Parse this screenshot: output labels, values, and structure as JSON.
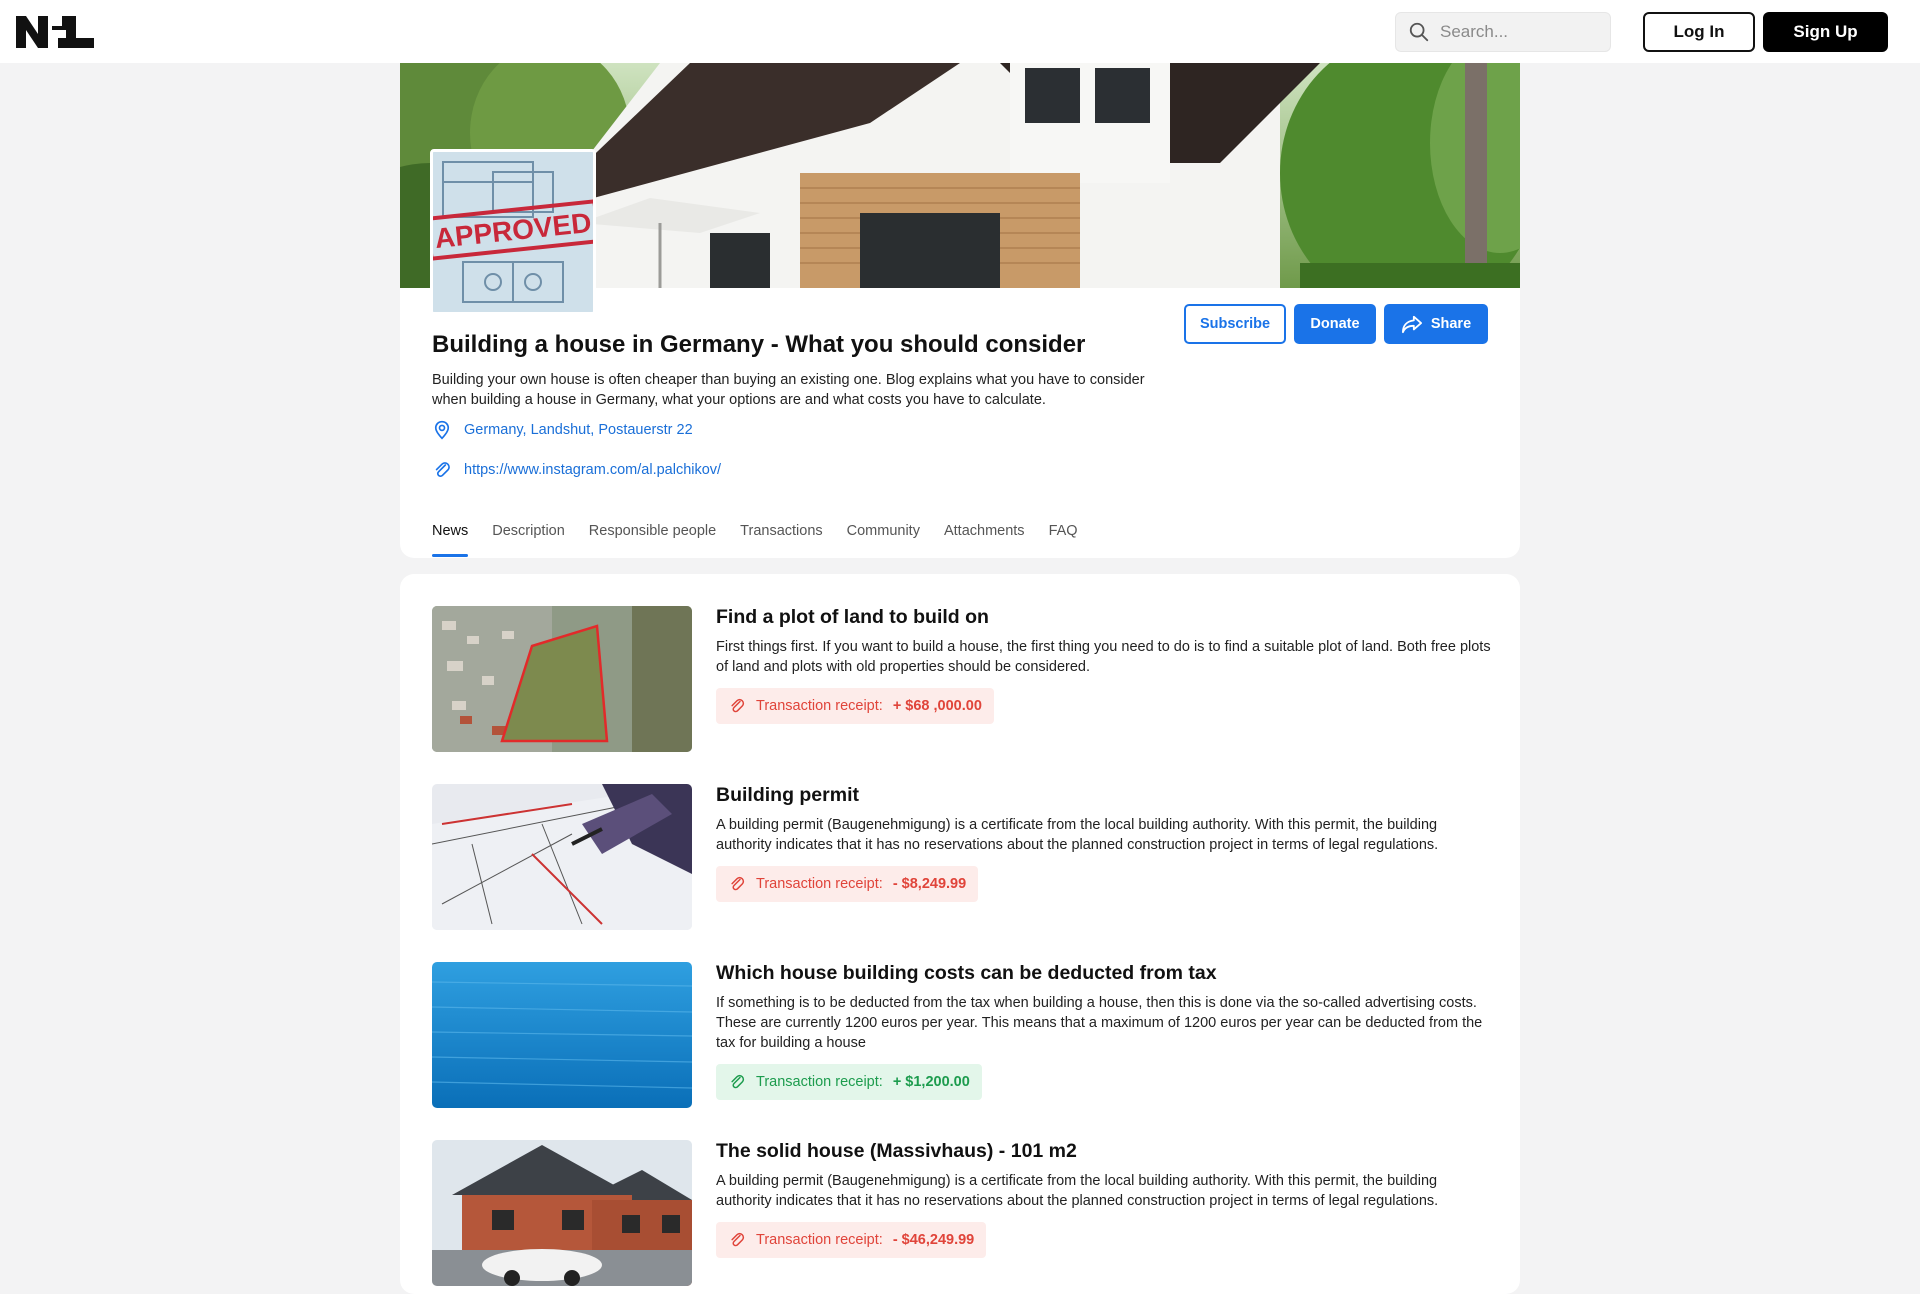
{
  "header": {
    "logo_alt": "N1",
    "search_placeholder": "Search...",
    "login_label": "Log In",
    "signup_label": "Sign Up"
  },
  "profile": {
    "cover_image": "house-cover",
    "avatar_image": "approved-blueprint",
    "avatar_stamp_text": "APPROVED",
    "title": "Building a house in Germany - What you should consider",
    "description": "Building your own house is often cheaper than buying an existing one. Blog explains what you have to consider when building a house in Germany, what your options are and what costs you have to calculate.",
    "location": "Germany, Landshut, Postauerstr 22",
    "link": "https://www.instagram.com/al.palchikov/",
    "subscribe_label": "Subscribe",
    "donate_label": "Donate",
    "share_label": "Share",
    "tabs": [
      {
        "label": "News",
        "active": true
      },
      {
        "label": "Description",
        "active": false
      },
      {
        "label": "Responsible people",
        "active": false
      },
      {
        "label": "Transactions",
        "active": false
      },
      {
        "label": "Community",
        "active": false
      },
      {
        "label": "Attachments",
        "active": false
      },
      {
        "label": "FAQ",
        "active": false
      }
    ]
  },
  "news": [
    {
      "title": "Find a plot of land to build on",
      "text": "First things first. If you want to build a house, the first thing you need to do is to find a suitable plot of land. Both free plots of land and plots with old properties should be considered.",
      "receipt_label": "Transaction receipt:",
      "amount": "+ $68 ,000.00",
      "tone": "neg",
      "image": "aerial-plot"
    },
    {
      "title": "Building permit",
      "text": "A building permit (Baugenehmigung)  is a certificate from the local building authority. With this permit, the building authority indicates that it has no reservations about the planned construction project in terms of legal regulations.",
      "receipt_label": "Transaction receipt:",
      "amount": "- $8,249.99",
      "tone": "neg",
      "image": "blueprint-pen"
    },
    {
      "title": "Which house building costs can be deducted from tax",
      "text": "If something is to be deducted from the tax when building a house, then this is done via the so-called advertising costs. These are currently 1200 euros per year. This means that a maximum of 1200 euros per year can be deducted from the tax for building a house",
      "receipt_label": "Transaction receipt:",
      "amount": "+ $1,200.00",
      "tone": "pos",
      "image": "sea-water"
    },
    {
      "title": " The solid house (Massivhaus) - 101 m2",
      "text": "A building permit (Baugenehmigung)  is a certificate from the local building authority. With this permit, the building authority indicates that it has no reservations about the planned construction project in terms of legal regulations.",
      "receipt_label": "Transaction receipt:",
      "amount": "- $46,249.99",
      "tone": "neg",
      "image": "brick-house"
    }
  ],
  "colors": {
    "accent": "#1a73e8",
    "negative": "#e0443a",
    "positive": "#1d9c4e"
  }
}
